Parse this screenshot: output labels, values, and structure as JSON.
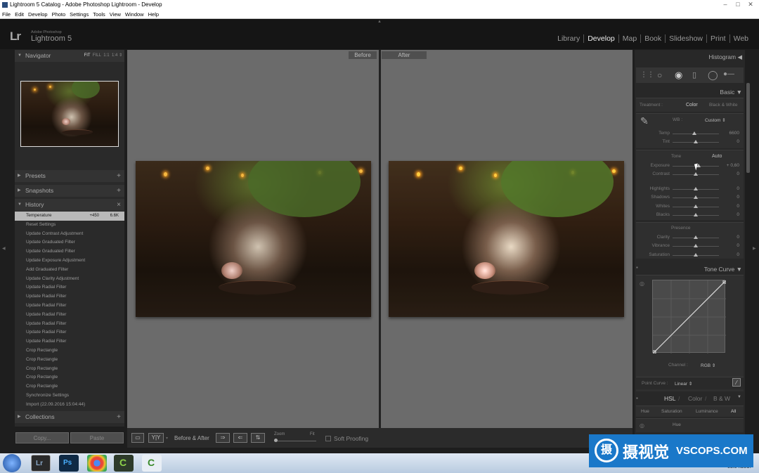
{
  "window": {
    "title": "Lightroom 5 Catalog - Adobe Photoshop Lightroom - Develop"
  },
  "menu": [
    "File",
    "Edit",
    "Develop",
    "Photo",
    "Settings",
    "Tools",
    "View",
    "Window",
    "Help"
  ],
  "brand": {
    "logo": "Lr",
    "small": "Adobe Photoshop",
    "name": "Lightroom 5"
  },
  "modules": [
    "Library",
    "Develop",
    "Map",
    "Book",
    "Slideshow",
    "Print",
    "Web"
  ],
  "active_module": "Develop",
  "navigator": {
    "title": "Navigator",
    "fit": "FIT",
    "fill": "FILL",
    "one": "1:1",
    "quarter": "1:4"
  },
  "panels": {
    "presets": "Presets",
    "snapshots": "Snapshots",
    "history": "History",
    "collections": "Collections"
  },
  "history": [
    {
      "label": "Temperature",
      "v1": "+450",
      "v2": "6.6K"
    },
    {
      "label": "Reset Settings"
    },
    {
      "label": "Update Contrast Adjustment"
    },
    {
      "label": "Update Graduated Filter"
    },
    {
      "label": "Update Graduated Filter"
    },
    {
      "label": "Update Exposure Adjustment"
    },
    {
      "label": "Add Graduated Filter"
    },
    {
      "label": "Update Clarity Adjustment"
    },
    {
      "label": "Update Radial Filter"
    },
    {
      "label": "Update Radial Filter"
    },
    {
      "label": "Update Radial Filter"
    },
    {
      "label": "Update Radial Filter"
    },
    {
      "label": "Update Radial Filter"
    },
    {
      "label": "Update Radial Filter"
    },
    {
      "label": "Update Radial Filter"
    },
    {
      "label": "Crop Rectangle"
    },
    {
      "label": "Crop Rectangle"
    },
    {
      "label": "Crop Rectangle"
    },
    {
      "label": "Crop Rectangle"
    },
    {
      "label": "Crop Rectangle"
    },
    {
      "label": "Synchronize Settings"
    },
    {
      "label": "Import (22.09.2016 15:04:44)"
    }
  ],
  "left_buttons": {
    "copy": "Copy...",
    "paste": "Paste"
  },
  "compare": {
    "before": "Before",
    "after": "After"
  },
  "toolbar": {
    "yy": "Y|Y",
    "mode": "Before & After",
    "zoom": "Zoom",
    "fit": "Fit",
    "soft_proofing": "Soft Proofing"
  },
  "right": {
    "histogram": "Histogram",
    "basic": "Basic",
    "treatment": "Treatment :",
    "color": "Color",
    "bw": "Black & White",
    "wb_label": "WB :",
    "wb_value": "Custom",
    "tone": "Tone",
    "auto": "Auto",
    "presence": "Presence",
    "tone_curve": "Tone Curve",
    "channel_label": "Channel :",
    "channel_value": "RGB",
    "point_curve_label": "Point Curve :",
    "point_curve_value": "Linear",
    "hsl": "HSL",
    "color_tab": "Color",
    "bw_tab": "B & W",
    "hsl_tabs": [
      "Hue",
      "Saturation",
      "Luminance",
      "All"
    ],
    "hue": "Hue",
    "sliders_wb": [
      {
        "label": "Temp",
        "value": "6600",
        "pos": 0.47
      },
      {
        "label": "Tint",
        "value": "0",
        "pos": 0.5
      }
    ],
    "sliders_tone": [
      {
        "label": "Exposure",
        "value": "+ 0,60",
        "pos": 0.56
      },
      {
        "label": "Contrast",
        "value": "0",
        "pos": 0.5
      }
    ],
    "sliders_tone2": [
      {
        "label": "Highlights",
        "value": "0",
        "pos": 0.5
      },
      {
        "label": "Shadows",
        "value": "0",
        "pos": 0.5
      },
      {
        "label": "Whites",
        "value": "0",
        "pos": 0.5
      },
      {
        "label": "Blacks",
        "value": "0",
        "pos": 0.5
      }
    ],
    "sliders_presence": [
      {
        "label": "Clarity",
        "value": "0",
        "pos": 0.5
      },
      {
        "label": "Vibrance",
        "value": "0",
        "pos": 0.5
      },
      {
        "label": "Saturation",
        "value": "0",
        "pos": 0.5
      }
    ]
  },
  "taskbar": {
    "time_date": "08.04.2017"
  },
  "watermark": {
    "cn": "摄视觉",
    "en": "VSCOPS.COM"
  }
}
